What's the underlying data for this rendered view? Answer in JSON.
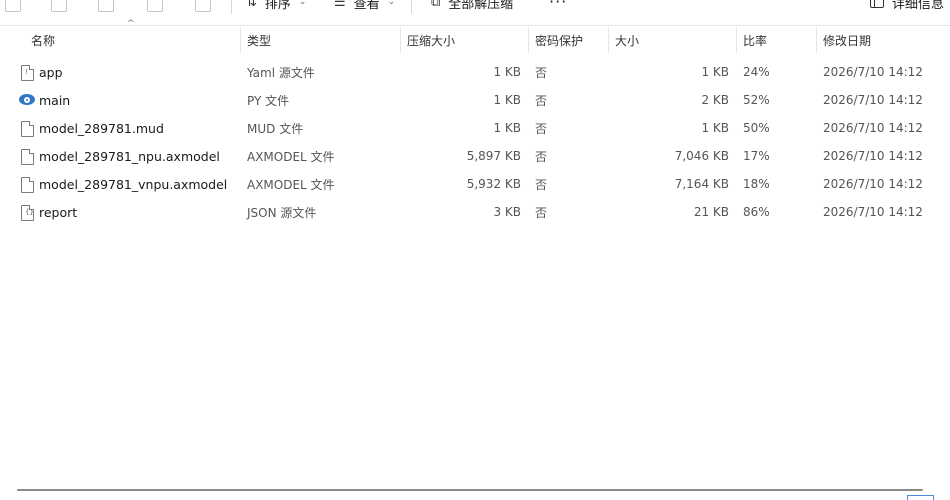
{
  "toolbar": {
    "sort_label": "排序",
    "view_label": "查看",
    "extract_all_label": "全部解压缩",
    "more_label": "···",
    "details_label": "详细信息"
  },
  "columns": {
    "name": "名称",
    "type": "类型",
    "packed_size": "压缩大小",
    "password": "密码保护",
    "size": "大小",
    "ratio": "比率",
    "modified": "修改日期"
  },
  "files": [
    {
      "name": "app",
      "type": "Yaml 源文件",
      "packed": "1 KB",
      "enc": "否",
      "size": "1 KB",
      "ratio": "24%",
      "date": "2026/7/10 14:12",
      "icon": "yaml-file-icon"
    },
    {
      "name": "main",
      "type": "PY 文件",
      "packed": "1 KB",
      "enc": "否",
      "size": "2 KB",
      "ratio": "52%",
      "date": "2026/7/10 14:12",
      "icon": "python-file-icon"
    },
    {
      "name": "model_289781.mud",
      "type": "MUD 文件",
      "packed": "1 KB",
      "enc": "否",
      "size": "1 KB",
      "ratio": "50%",
      "date": "2026/7/10 14:12",
      "icon": "file-icon"
    },
    {
      "name": "model_289781_npu.axmodel",
      "type": "AXMODEL 文件",
      "packed": "5,897 KB",
      "enc": "否",
      "size": "7,046 KB",
      "ratio": "17%",
      "date": "2026/7/10 14:12",
      "icon": "file-icon"
    },
    {
      "name": "model_289781_vnpu.axmodel",
      "type": "AXMODEL 文件",
      "packed": "5,932 KB",
      "enc": "否",
      "size": "7,164 KB",
      "ratio": "18%",
      "date": "2026/7/10 14:12",
      "icon": "file-icon"
    },
    {
      "name": "report",
      "type": "JSON 源文件",
      "packed": "3 KB",
      "enc": "否",
      "size": "21 KB",
      "ratio": "86%",
      "date": "2026/7/10 14:12",
      "icon": "json-file-icon"
    }
  ]
}
